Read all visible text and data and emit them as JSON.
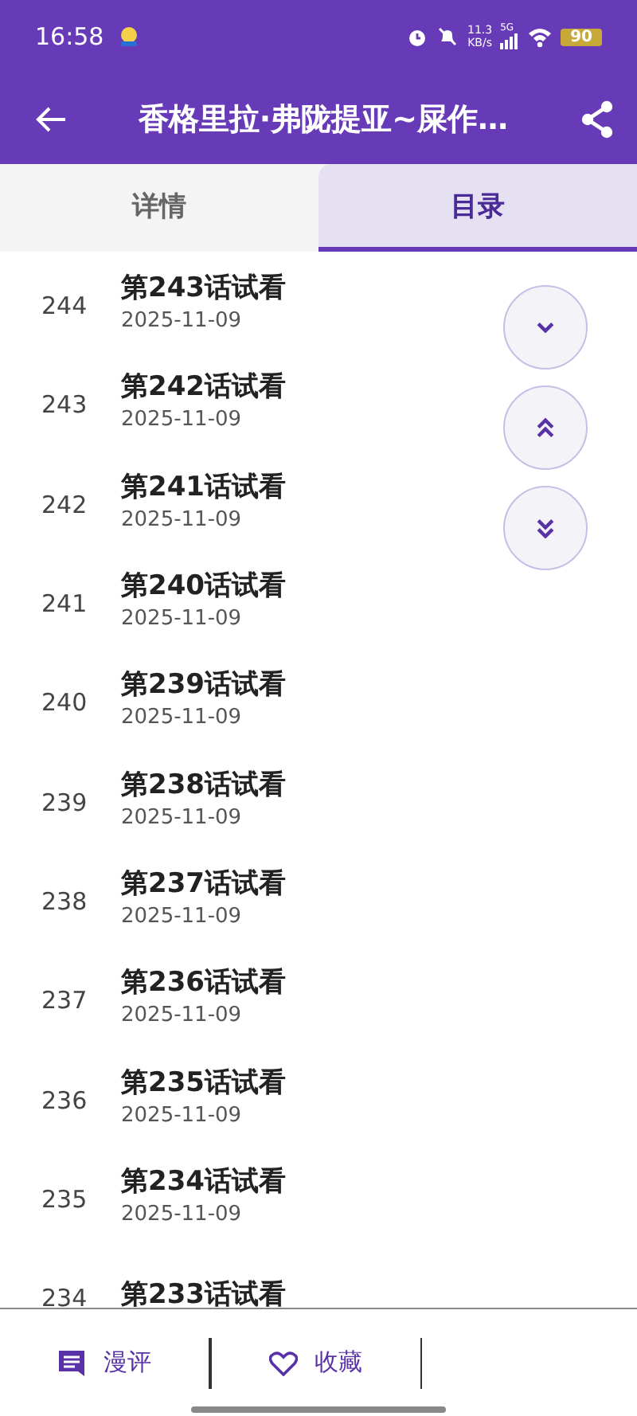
{
  "status_bar": {
    "time": "16:58",
    "net_speed": "11.3",
    "net_unit": "KB/s",
    "network": "5G",
    "battery": "90"
  },
  "header": {
    "title": "香格里拉·弗陇提亚~屎作…"
  },
  "tabs": [
    {
      "label": "详情",
      "selected": false
    },
    {
      "label": "目录",
      "selected": true
    }
  ],
  "chapters": [
    {
      "index": "244",
      "title": "第243话试看",
      "date": "2025-11-09"
    },
    {
      "index": "243",
      "title": "第242话试看",
      "date": "2025-11-09"
    },
    {
      "index": "242",
      "title": "第241话试看",
      "date": "2025-11-09"
    },
    {
      "index": "241",
      "title": "第240话试看",
      "date": "2025-11-09"
    },
    {
      "index": "240",
      "title": "第239话试看",
      "date": "2025-11-09"
    },
    {
      "index": "239",
      "title": "第238话试看",
      "date": "2025-11-09"
    },
    {
      "index": "238",
      "title": "第237话试看",
      "date": "2025-11-09"
    },
    {
      "index": "237",
      "title": "第236话试看",
      "date": "2025-11-09"
    },
    {
      "index": "236",
      "title": "第235话试看",
      "date": "2025-11-09"
    },
    {
      "index": "235",
      "title": "第234话试看",
      "date": "2025-11-09"
    },
    {
      "index": "234",
      "title": "第233话试看"
    }
  ],
  "fab_buttons": [
    {
      "kind": "down"
    },
    {
      "kind": "top"
    },
    {
      "kind": "bottom"
    }
  ],
  "bottom_bar": [
    {
      "kind": "comment",
      "label": "漫评"
    },
    {
      "kind": "favorite",
      "label": "收藏"
    }
  ]
}
